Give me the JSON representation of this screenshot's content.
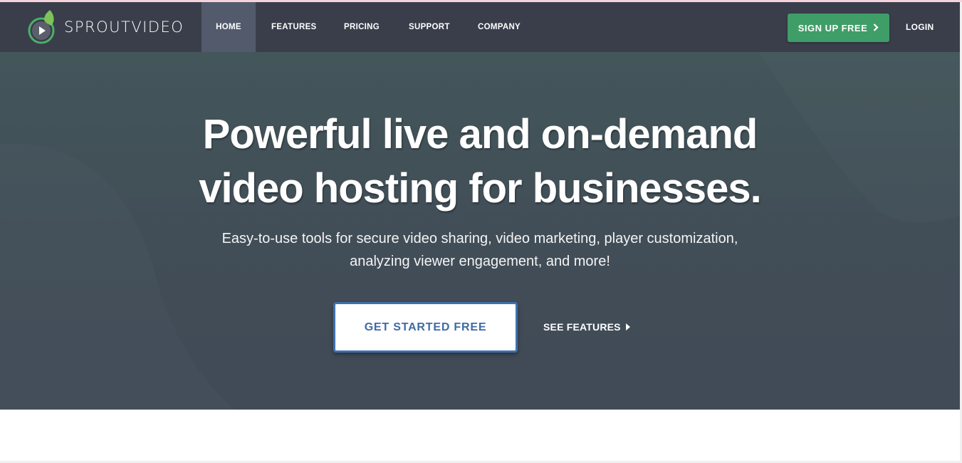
{
  "brand": {
    "name": "SPROUTVIDEO",
    "colors": {
      "nav_bg": "#393e4a",
      "nav_active": "#525a6b",
      "accent_green": "#3f9d68",
      "cta_blue": "#3f70b0",
      "hero_top": "#43565a",
      "hero_bottom": "#414a57"
    }
  },
  "nav": {
    "items": [
      {
        "label": "HOME",
        "active": true
      },
      {
        "label": "FEATURES",
        "active": false
      },
      {
        "label": "PRICING",
        "active": false
      },
      {
        "label": "SUPPORT",
        "active": false
      },
      {
        "label": "COMPANY",
        "active": false
      }
    ],
    "signup_label": "SIGN UP FREE",
    "signup_icon": "chevron-right-icon",
    "login_label": "LOGIN"
  },
  "hero": {
    "headline_line1": "Powerful live and on-demand",
    "headline_line2": "video hosting for businesses.",
    "subtext_line1": "Easy-to-use tools for secure video sharing, video marketing, player customization,",
    "subtext_line2": "analyzing viewer engagement, and more!",
    "cta_label": "GET STARTED FREE",
    "secondary_label": "SEE FEATURES",
    "secondary_icon": "caret-right-icon"
  }
}
